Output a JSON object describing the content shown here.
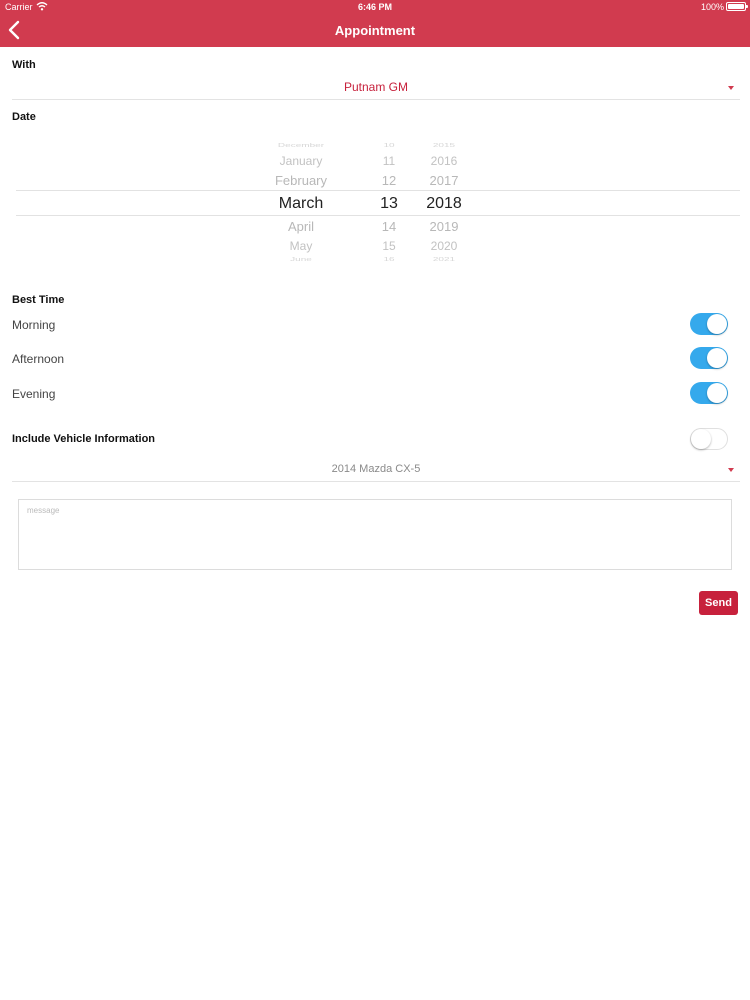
{
  "status_bar": {
    "carrier": "Carrier",
    "time": "6:46 PM",
    "battery": "100%"
  },
  "nav": {
    "title": "Appointment",
    "back_icon": "chevron-left-icon"
  },
  "with": {
    "label": "With",
    "value": "Putnam GM"
  },
  "date": {
    "label": "Date",
    "months": [
      "December",
      "January",
      "February",
      "March",
      "April",
      "May",
      "June"
    ],
    "days": [
      "10",
      "11",
      "12",
      "13",
      "14",
      "15",
      "16"
    ],
    "years": [
      "2015",
      "2016",
      "2017",
      "2018",
      "2019",
      "2020",
      "2021"
    ],
    "selected": {
      "month": "March",
      "day": "13",
      "year": "2018"
    }
  },
  "best_time": {
    "label": "Best Time",
    "options": [
      {
        "label": "Morning",
        "on": true
      },
      {
        "label": "Afternoon",
        "on": true
      },
      {
        "label": "Evening",
        "on": true
      }
    ]
  },
  "vehicle": {
    "label": "Include Vehicle Information",
    "on": false,
    "value": "2014 Mazda CX-5"
  },
  "message": {
    "placeholder": "message",
    "value": ""
  },
  "send": {
    "label": "Send"
  },
  "colors": {
    "header": "#d13b4f",
    "accent": "#c7213c",
    "toggle_on": "#35a9ec",
    "dropdown_text": "#c7213c",
    "vehicle_text": "#8a8a8a"
  }
}
